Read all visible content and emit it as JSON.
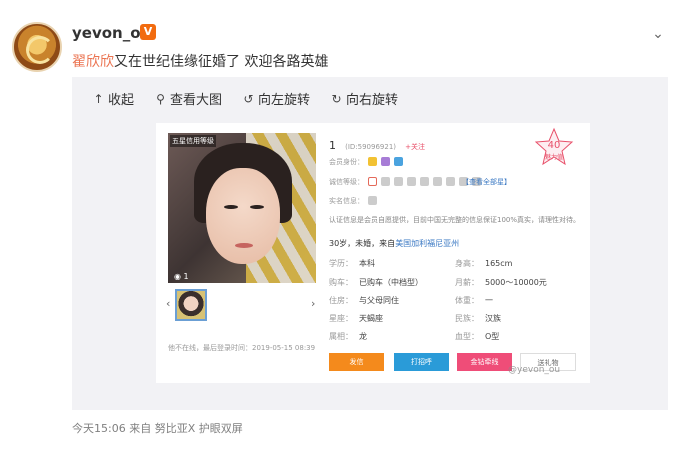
{
  "post": {
    "username": "yevon_ou",
    "verified_badge": "V",
    "mention": "翟欣欣",
    "text": "又在世纪佳缘征婚了 欢迎各路英雄",
    "meta": "今天15:06 来自 努比亚X 护眼双屏"
  },
  "toolbar": {
    "collapse": "收起",
    "view_large": "查看大图",
    "rotate_left": "向左旋转",
    "rotate_right": "向右旋转"
  },
  "profile": {
    "id_number": "1",
    "id_code": "(ID:59096921)",
    "follow": "+关注",
    "charm_value": "40",
    "charm_label": "魅力值",
    "photo_label": "五星信用等级",
    "photo_count": "1",
    "member_label": "会员身份：",
    "integrity_label": "诚信等级：",
    "integrity_link": "【查看全部星】",
    "realname_label": "实名信息：",
    "description": "认证信息是会员自愿提供，目前中国无完整的信息保证100%真实，请理性对待。",
    "age_prefix": "30岁，未婚，来自",
    "city": "美国加利福尼亚州",
    "attributes": [
      {
        "k": "学历：",
        "v": "本科"
      },
      {
        "k": "身高：",
        "v": "165cm"
      },
      {
        "k": "购车：",
        "v": "已购车（中档型）"
      },
      {
        "k": "月薪：",
        "v": "5000～10000元"
      },
      {
        "k": "住房：",
        "v": "与父母同住"
      },
      {
        "k": "体重：",
        "v": "一"
      },
      {
        "k": "星座：",
        "v": "天蝎座"
      },
      {
        "k": "民族：",
        "v": "汉族"
      },
      {
        "k": "属相：",
        "v": "龙"
      },
      {
        "k": "血型：",
        "v": "O型"
      }
    ],
    "footnote": "他不在线，最后登录时间：2019-05-15 08:39",
    "buttons": {
      "message": "发信",
      "greet": "打招呼",
      "gold": "金钻牵线",
      "gift": "送礼物"
    }
  },
  "watermark": "@yevon_ou"
}
